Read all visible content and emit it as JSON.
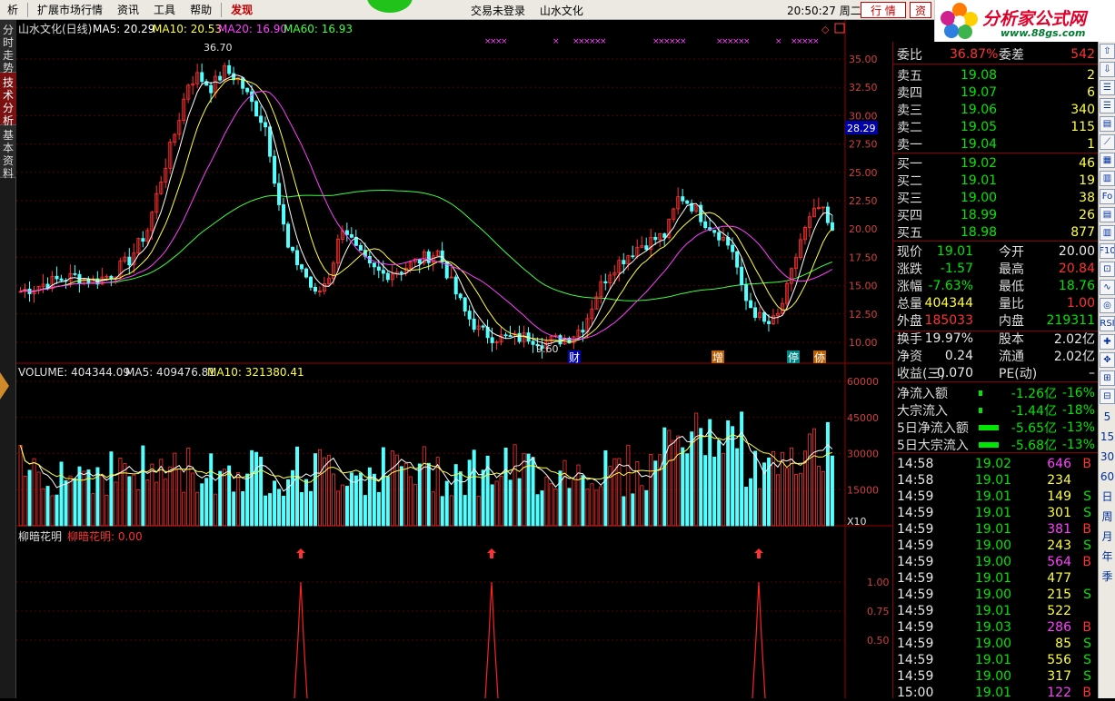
{
  "menu": {
    "items": [
      "析",
      "扩展市场行情",
      "资讯",
      "工具",
      "帮助",
      "发现"
    ],
    "status": "交易未登录",
    "stock": "山水文化",
    "clock": "20:50:27 周二",
    "btn_quote": "行 情",
    "btn_trade": "资"
  },
  "logo": {
    "title": "分析家公式网",
    "url": "www.88gs.com"
  },
  "left_tabs": [
    "分时走势",
    "技术分析",
    "基本资料"
  ],
  "price_panel": {
    "title": "山水文化(日线)",
    "ma": [
      {
        "label": "MA5: 20.29",
        "color": "#ffffff"
      },
      {
        "label": "MA10: 20.53",
        "color": "#ffff40"
      },
      {
        "label": "MA20: 16.90",
        "color": "#ff40ff"
      },
      {
        "label": "MA60: 16.93",
        "color": "#40ff40"
      }
    ],
    "yticks": [
      "35.00",
      "32.50",
      "30.00",
      "27.50",
      "25.00",
      "22.50",
      "20.00",
      "17.50",
      "15.00",
      "12.50",
      "10.00"
    ],
    "current_price_tag": "28.29",
    "high_label": "36.70",
    "low_label": "9.60",
    "events": [
      {
        "label": "财",
        "bg": "#0000c0"
      },
      {
        "label": "增",
        "bg": "#c06000"
      },
      {
        "label": "停",
        "bg": "#008888"
      },
      {
        "label": "㑊",
        "bg": "#c06000"
      }
    ]
  },
  "volume_panel": {
    "label": "VOLUME: 404344.09",
    "ma5": "MA5: 409476.81",
    "ma10": "MA10: 321380.41",
    "yticks": [
      "60000",
      "45000",
      "30000",
      "15000"
    ],
    "unit": "X10"
  },
  "indicator_panel": {
    "name": "柳暗花明",
    "value_label": "柳暗花明: 0.00",
    "yticks": [
      "1.00",
      "0.75",
      "0.50"
    ]
  },
  "quote": {
    "weibi": {
      "label": "委比",
      "value": "36.87%",
      "label2": "委差",
      "value2": "542"
    },
    "asks": [
      {
        "label": "卖五",
        "price": "19.08",
        "vol": "2"
      },
      {
        "label": "卖四",
        "price": "19.07",
        "vol": "6"
      },
      {
        "label": "卖三",
        "price": "19.06",
        "vol": "340"
      },
      {
        "label": "卖二",
        "price": "19.05",
        "vol": "115"
      },
      {
        "label": "卖一",
        "price": "19.04",
        "vol": "1"
      }
    ],
    "bids": [
      {
        "label": "买一",
        "price": "19.02",
        "vol": "46"
      },
      {
        "label": "买二",
        "price": "19.01",
        "vol": "19"
      },
      {
        "label": "买三",
        "price": "19.00",
        "vol": "38"
      },
      {
        "label": "买四",
        "price": "18.99",
        "vol": "26"
      },
      {
        "label": "买五",
        "price": "18.98",
        "vol": "877"
      }
    ],
    "stats": [
      {
        "l1": "现价",
        "v1": "19.01",
        "c1": "dn",
        "l2": "今开",
        "v2": "20.00",
        "c2": "wh"
      },
      {
        "l1": "涨跌",
        "v1": "-1.57",
        "c1": "dn",
        "l2": "最高",
        "v2": "20.84",
        "c2": "up"
      },
      {
        "l1": "涨幅",
        "v1": "-7.63%",
        "c1": "dn",
        "l2": "最低",
        "v2": "18.76",
        "c2": "dn"
      },
      {
        "l1": "总量",
        "v1": "404344",
        "c1": "yl",
        "l2": "量比",
        "v2": "1.00",
        "c2": "up"
      },
      {
        "l1": "外盘",
        "v1": "185033",
        "c1": "up",
        "l2": "内盘",
        "v2": "219311",
        "c2": "dn"
      },
      {
        "l1": "换手",
        "v1": "19.97%",
        "c1": "wh",
        "l2": "股本",
        "v2": "2.02亿",
        "c2": "wh"
      },
      {
        "l1": "净资",
        "v1": "0.24",
        "c1": "wh",
        "l2": "流通",
        "v2": "2.02亿",
        "c2": "wh"
      },
      {
        "l1": "收益(三)",
        "v1": "-0.070",
        "c1": "wh",
        "l2": "PE(动)",
        "v2": "–",
        "c2": "wh"
      }
    ],
    "flows": [
      {
        "label": "净流入额",
        "value": "-1.26亿",
        "pct": "-16%"
      },
      {
        "label": "大宗流入",
        "value": "-1.44亿",
        "pct": "-18%"
      },
      {
        "label": "5日净流入额",
        "value": "-5.65亿",
        "pct": "-13%"
      },
      {
        "label": "5日大宗流入",
        "value": "-5.68亿",
        "pct": "-13%"
      }
    ],
    "ticks": [
      {
        "time": "14:58",
        "price": "19.02",
        "vol": "646",
        "side": "B"
      },
      {
        "time": "14:58",
        "price": "19.01",
        "vol": "234",
        "side": ""
      },
      {
        "time": "14:59",
        "price": "19.01",
        "vol": "149",
        "side": "S"
      },
      {
        "time": "14:59",
        "price": "19.01",
        "vol": "301",
        "side": "S"
      },
      {
        "time": "14:59",
        "price": "19.01",
        "vol": "381",
        "side": "B"
      },
      {
        "time": "14:59",
        "price": "19.00",
        "vol": "243",
        "side": "S"
      },
      {
        "time": "14:59",
        "price": "19.00",
        "vol": "564",
        "side": "B"
      },
      {
        "time": "14:59",
        "price": "19.01",
        "vol": "477",
        "side": ""
      },
      {
        "time": "14:59",
        "price": "19.00",
        "vol": "215",
        "side": "S"
      },
      {
        "time": "14:59",
        "price": "19.01",
        "vol": "522",
        "side": ""
      },
      {
        "time": "14:59",
        "price": "19.03",
        "vol": "286",
        "side": "B"
      },
      {
        "time": "14:59",
        "price": "19.00",
        "vol": "85",
        "side": "S"
      },
      {
        "time": "14:59",
        "price": "19.01",
        "vol": "556",
        "side": "S"
      },
      {
        "time": "14:59",
        "price": "19.00",
        "vol": "317",
        "side": "S"
      },
      {
        "time": "15:00",
        "price": "19.01",
        "vol": "122",
        "side": "B"
      }
    ]
  },
  "right_tools": [
    "⇧",
    "⇩",
    "☰",
    "☰",
    "▤",
    "⟋",
    "▦",
    "▥",
    "Fo",
    "▤",
    "▥",
    "F10",
    "⊡",
    "∿",
    "◎",
    "RSI",
    "✚",
    "✥",
    "⊞",
    "⊟",
    "5",
    "15",
    "30",
    "60",
    "日",
    "周",
    "月",
    "年",
    "季"
  ],
  "colors": {
    "up": "#ff3232",
    "down": "#54ffff",
    "grid": "#800000"
  }
}
